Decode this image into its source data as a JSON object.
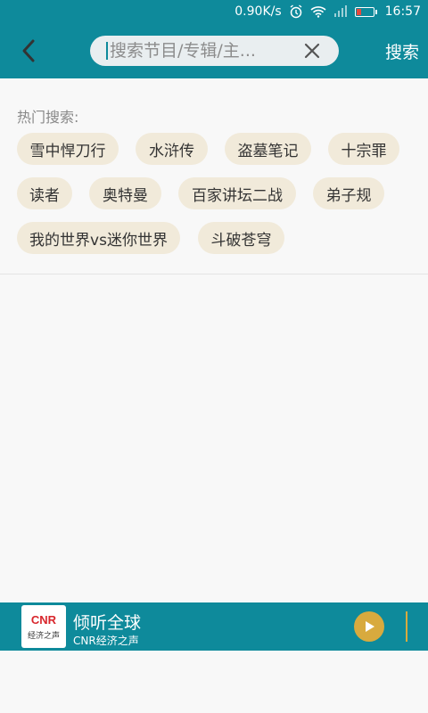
{
  "status_bar": {
    "speed": "0.90K/s",
    "time": "16:57",
    "alarm_icon": "alarm-icon",
    "wifi_icon": "wifi-icon",
    "signal_icon": "signal-icon",
    "battery_icon": "battery-icon",
    "battery_color": "#e8473c"
  },
  "header": {
    "back_icon": "chevron-left-icon",
    "search_placeholder": "搜索节目/专辑/主...",
    "clear_icon": "close-icon",
    "search_label": "搜索"
  },
  "hot": {
    "title": "热门搜索:",
    "tags": [
      "雪中悍刀行",
      "水浒传",
      "盗墓笔记",
      "十宗罪",
      "读者",
      "奥特曼",
      "百家讲坛二战",
      "弟子规",
      "我的世界vs迷你世界",
      "斗破苍穹"
    ]
  },
  "player": {
    "logo_text": "CNR",
    "logo_subtext": "经济之声",
    "title": "倾听全球",
    "subtitle": "CNR经济之声",
    "play_icon": "play-icon"
  },
  "colors": {
    "primary": "#0e8a9b",
    "tag_background": "#f1eada",
    "accent_gold": "#d8aa3e"
  }
}
